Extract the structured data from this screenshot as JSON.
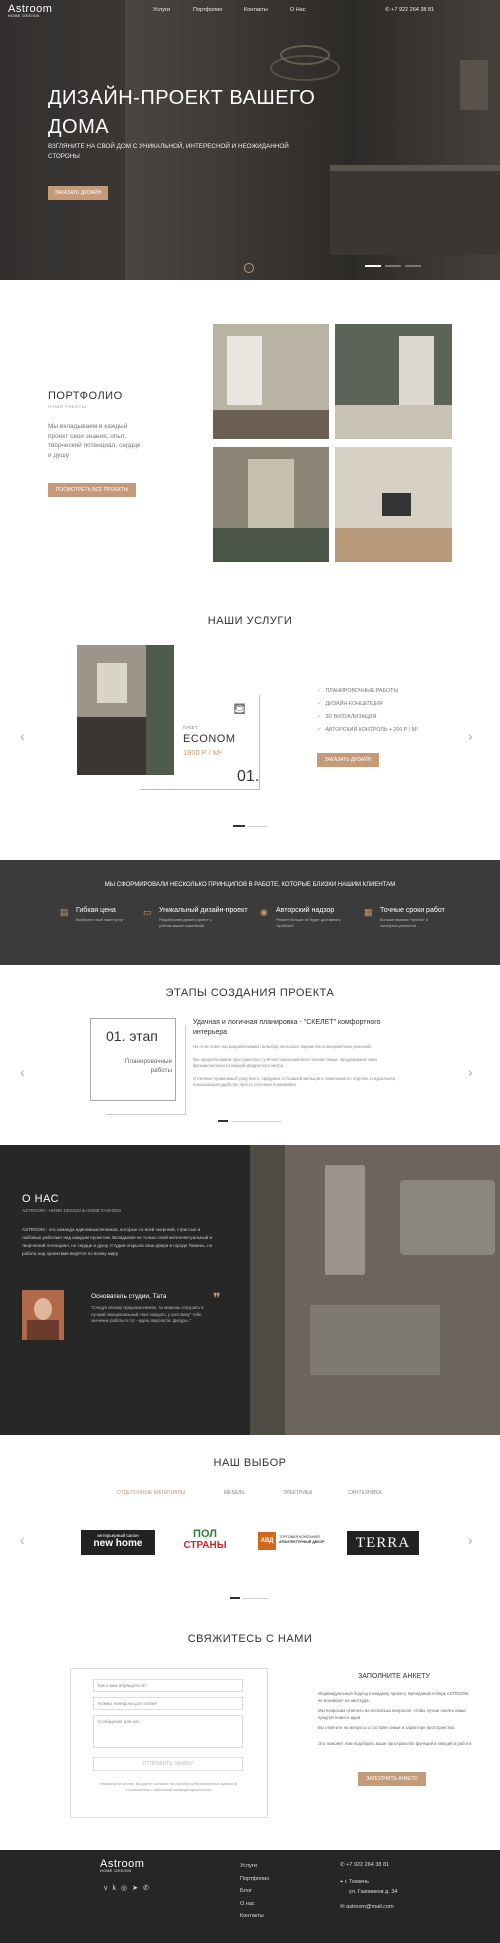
{
  "header": {
    "logo": "Astroom",
    "logo_sub": "HOME DESIGN",
    "nav": [
      "Услуги",
      "Портфолио",
      "Контакты",
      "О Нас"
    ],
    "phone": "+7 922 264 38 81"
  },
  "hero": {
    "title": "ДИЗАЙН-ПРОЕКТ ВАШЕГО ДОМА",
    "subtitle": "ВЗГЛЯНИТЕ НА СВОЙ ДОМ С УНИКАЛЬНОЙ, ИНТЕРЕСНОЙ И НЕОЖИДАННОЙ СТОРОНЫ",
    "cta": "ЗАКАЗАТЬ ДИЗАЙН"
  },
  "portfolio": {
    "title": "ПОРТФОЛИО",
    "subtitle": "НАШИ РАБОТЫ",
    "text": "Мы вкладываем в каждый проект свои знания, опыт, творческий потенциал, сердце и душу",
    "cta": "ПОСМОТРЕТЬ ВСЕ ПРОЕКТЫ"
  },
  "services": {
    "title": "НАШИ УСЛУГИ",
    "package_label": "ПАКЕТ",
    "package_name": "ECONOM",
    "price": "1900 Р / М²",
    "number": "01.",
    "features": [
      "ПЛАНИРОВОЧНЫЕ РАБОТЫ",
      "ДИЗАЙН-КОНЦЕПЦИЯ",
      "3D ВИЗУАЛИЗАЦИЯ",
      "АВТОРСКИЙ КОНТРОЛЬ + 200 Р / М²"
    ],
    "cta": "ЗАКАЗАТЬ ДИЗАЙН"
  },
  "principles": {
    "title": "МЫ СФОРМИРОВАЛИ НЕСКОЛЬКО ПРИНЦИПОВ В РАБОТЕ, КОТОРЫЕ БЛИЗКИ НАШИМ КЛИЕНТАМ",
    "items": [
      {
        "title": "Гибкая цена",
        "text": "Выберите свой пакет услуг"
      },
      {
        "title": "Уникальный дизайн-проект",
        "text": "Разработаем дизайн-проект с учётом ваших пожеланий"
      },
      {
        "title": "Авторский надзор",
        "text": "Ремонт больше не будет доставлять \"проблем\""
      },
      {
        "title": "Точные сроки работ",
        "text": "Больше никаких \"пробок\" и затянутых ремонтов"
      }
    ]
  },
  "stages": {
    "title": "ЭТАПЫ СОЗДАНИЯ ПРОЕКТА",
    "stage_number": "01. этап",
    "stage_name": "Планировочные работы",
    "heading": "Удачная и логичная планировка - \"СКЕЛЕТ\" комфортного интерьера",
    "p1": "На этом этапе мы разрабатываем на выбор несколько вариантов планировочных решений.",
    "p2": "Мы прорабатываем пространство с учётом пожеланий всех членов семьи, продумываем зоны функциональности каждой квадратного метра.",
    "p3": "Отличные правильный уход всего, продумка от бывшей жильцов и пожеланий по отделке, и идеальная, повышающая удобство просто логичная планировка."
  },
  "about": {
    "title": "О НАС",
    "subtitle": "ASTROOM - HOME DESIGN & HOME FASHION",
    "text": "ASTROOM - это команда единомышленников, которые со всей энергией, страстью и любовью работают над каждым проектом. Вкладывая не только свой интеллектуальный и творческий потенциал, но сердце и душу. Студия открыла свои двери в городе Тюмень, но работа над проектами ведётся по всему миру.",
    "founder_title": "Основатель студии, Тата",
    "quote": "\"Следуя своему предназначению, ты можешь погрузить в лучший эмоциональный опыт каждого, у кого вижу\" тебе значение работы в тот - идею, вкусности, фигуры..\""
  },
  "choice": {
    "title": "НАШ ВЫБОР",
    "tabs": [
      "ОТДЕЛОЧНЫЕ МАТЕРИАЛЫ",
      "МЕБЕЛЬ",
      "ЭЛЕКТРИКА",
      "САНТЕХНИКА"
    ],
    "brands": [
      {
        "line1": "интерьерный салон",
        "line2": "new home"
      },
      {
        "line1": "ПОЛ",
        "line2": "СТРАНЫ"
      },
      {
        "line1": "ТОРГОВАЯ КОМПАНИЯ",
        "line2": "АРХИТЕКТУРНЫЙ ДЕКОР"
      },
      {
        "line1": "TERRA",
        "line2": ""
      }
    ]
  },
  "contact": {
    "title": "СВЯЖИТЕСЬ С НАМИ",
    "name_placeholder": "Как к вам обращаться?",
    "phone_placeholder": "Номер телефона для связи*",
    "message_placeholder": "Сообщение для нас",
    "submit": "ОТПРАВИТЬ ЗАЯВКУ",
    "consent": "Нажимая на кнопку, вы даёте согласие на обработку персональных данных и соглашаетесь с политикой конфиденциальности",
    "survey_title": "ЗАПОЛНИТЕ АНКЕТУ",
    "survey_p1": "Индивидуальный подход к каждому проекту. Брендовый почерк ASTROOM не возникает из ниоткуда.",
    "survey_p2": "Мы попросим ответить на несколько вопросов, чтобы лучше понять ваши предпочтения и идеи.",
    "survey_p3": "Вы ответите на вопросы о составе семьи и характере пространства.",
    "survey_p4": "Это поможет нам подобрать ваше пространство функций и эмоций в работе.",
    "survey_cta": "ЗАПОЛНИТЬ АНКЕТУ"
  },
  "footer": {
    "logo": "Astroom",
    "logo_sub": "HOME DESIGN",
    "links": [
      "Услуги",
      "Портфолио",
      "Блог",
      "О нас",
      "Контакты"
    ],
    "phone": "+7 922 264 38 81",
    "city": "г. Тюмень",
    "street": "ул. Газовиков д. 34",
    "email": "astroom@mail.com"
  },
  "colors": {
    "accent": "#c49a78",
    "dark": "#272727"
  }
}
